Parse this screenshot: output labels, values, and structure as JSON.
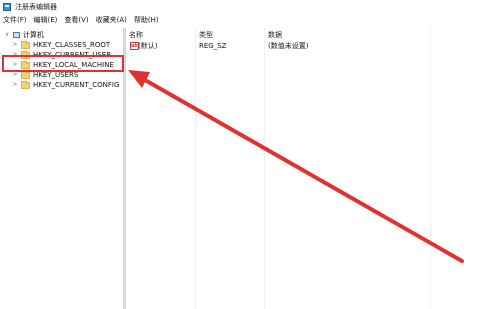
{
  "window": {
    "title": "注册表编辑器",
    "icon": "registry-icon"
  },
  "menu": {
    "items": [
      "文件(F)",
      "编辑(E)",
      "查看(V)",
      "收藏夹(A)",
      "帮助(H)"
    ]
  },
  "tree": {
    "root": "计算机",
    "keys": [
      "HKEY_CLASSES_ROOT",
      "HKEY_CURRENT_USER",
      "HKEY_LOCAL_MACHINE",
      "HKEY_USERS",
      "HKEY_CURRENT_CONFIG"
    ]
  },
  "list": {
    "columns": [
      "名称",
      "类型",
      "数据"
    ],
    "rows": [
      {
        "name": "(默认)",
        "type": "REG_SZ",
        "data": "(数值未设置)",
        "icon": "string-value-icon"
      }
    ]
  },
  "annotation": {
    "highlight_color": "#e03131"
  }
}
